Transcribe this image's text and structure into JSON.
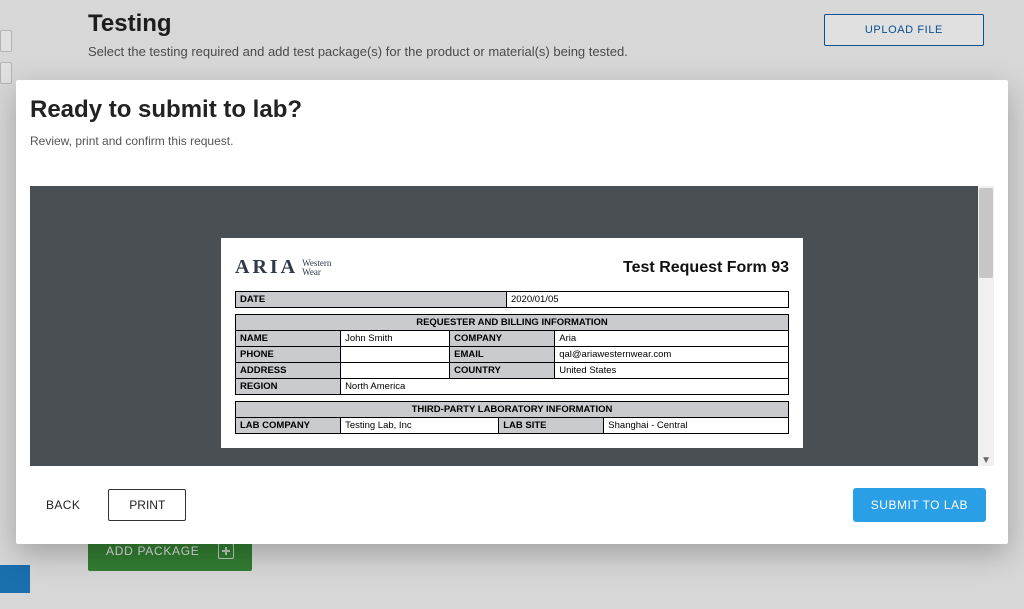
{
  "page": {
    "title": "Testing",
    "subtitle": "Select the testing required and add test package(s) for the product or material(s) being tested.",
    "upload_button": "UPLOAD FILE",
    "add_package": "ADD PACKAGE"
  },
  "modal": {
    "title": "Ready to submit to lab?",
    "subtitle": "Review, print and confirm this request.",
    "buttons": {
      "back": "BACK",
      "print": "PRINT",
      "submit": "SUBMIT TO LAB"
    }
  },
  "doc": {
    "logo_main": "ARIA",
    "logo_sub1": "Western",
    "logo_sub2": "Wear",
    "title": "Test Request Form 93",
    "date_label": "DATE",
    "date_value": "2020/01/05",
    "sections": {
      "requester": "REQUESTER AND BILLING INFORMATION",
      "lab": "THIRD-PARTY LABORATORY INFORMATION"
    },
    "fields": {
      "name_label": "NAME",
      "name_value": "John Smith",
      "company_label": "COMPANY",
      "company_value": "Aria",
      "phone_label": "PHONE",
      "phone_value": "",
      "email_label": "EMAIL",
      "email_value": "qal@ariawesternwear.com",
      "address_label": "ADDRESS",
      "address_value": "",
      "country_label": "COUNTRY",
      "country_value": "United States",
      "region_label": "REGION",
      "region_value": "North America",
      "labcompany_label": "LAB COMPANY",
      "labcompany_value": "Testing Lab, Inc",
      "labsite_label": "LAB SITE",
      "labsite_value": "Shanghai - Central"
    }
  }
}
